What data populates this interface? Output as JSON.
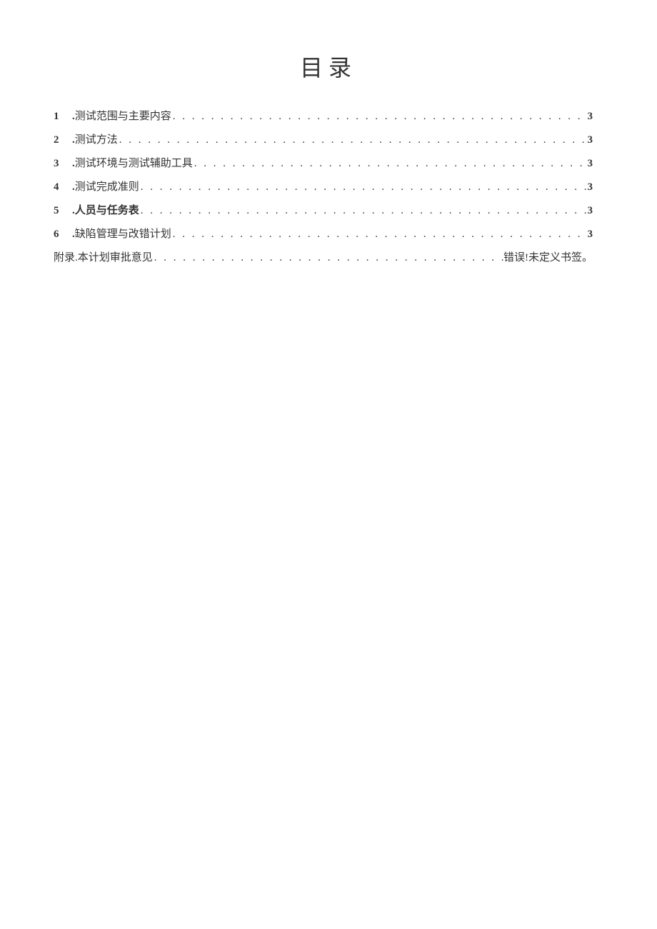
{
  "title": "目录",
  "toc": [
    {
      "num": "1",
      "sep": ".",
      "label": "测试范围与主要内容",
      "page": "3",
      "bold": true
    },
    {
      "num": "2",
      "sep": ".",
      "label": "测试方法",
      "page": "3",
      "bold": true
    },
    {
      "num": "3",
      "sep": ".",
      "label": "测试环境与测试辅助工具",
      "page": "3",
      "bold": true
    },
    {
      "num": "4",
      "sep": ".",
      "label": "测试完成准则",
      "page": "3",
      "bold": true
    },
    {
      "num": "5",
      "sep": ".",
      "label": "人员与任务表",
      "page": "3",
      "bold": true
    },
    {
      "num": "6",
      "sep": ".",
      "label": "缺陷管理与改错计划",
      "page": "3",
      "bold": true
    }
  ],
  "appendix": {
    "prefix": "附录.",
    "label": " 本计划审批意见",
    "page": "错误!未定义书签。"
  }
}
